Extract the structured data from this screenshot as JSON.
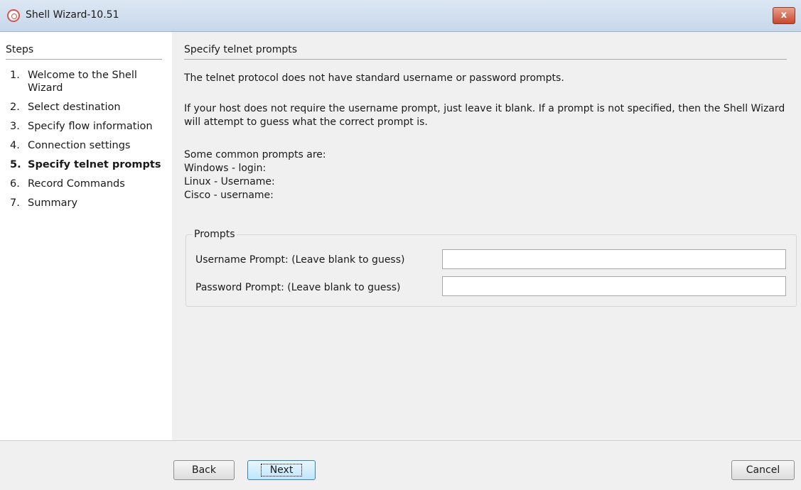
{
  "window": {
    "title": "Shell Wizard-10.51",
    "close_label": "x"
  },
  "sidebar": {
    "heading": "Steps",
    "items": [
      {
        "num": "1.",
        "label": "Welcome to the Shell Wizard"
      },
      {
        "num": "2.",
        "label": "Select destination"
      },
      {
        "num": "3.",
        "label": "Specify flow information"
      },
      {
        "num": "4.",
        "label": "Connection settings"
      },
      {
        "num": "5.",
        "label": "Specify telnet prompts",
        "active": true
      },
      {
        "num": "6.",
        "label": "Record Commands"
      },
      {
        "num": "7.",
        "label": "Summary"
      }
    ]
  },
  "main": {
    "title": "Specify telnet prompts",
    "intro": "The telnet protocol does not have standard username or password prompts.",
    "blank_note": "If your host does not require the username prompt, just leave it blank. If a prompt is not specified, then the Shell Wizard will attempt to guess what the correct prompt is.",
    "common_heading": "Some common prompts are:",
    "examples": [
      "Windows - login:",
      "Linux - Username:",
      "Cisco - username:"
    ],
    "prompts": {
      "legend": "Prompts",
      "username_label": "Username Prompt: (Leave blank to guess)",
      "username_value": "",
      "password_label": "Password Prompt:  (Leave blank to guess)",
      "password_value": ""
    }
  },
  "footer": {
    "back": "Back",
    "next": "Next",
    "cancel": "Cancel"
  }
}
